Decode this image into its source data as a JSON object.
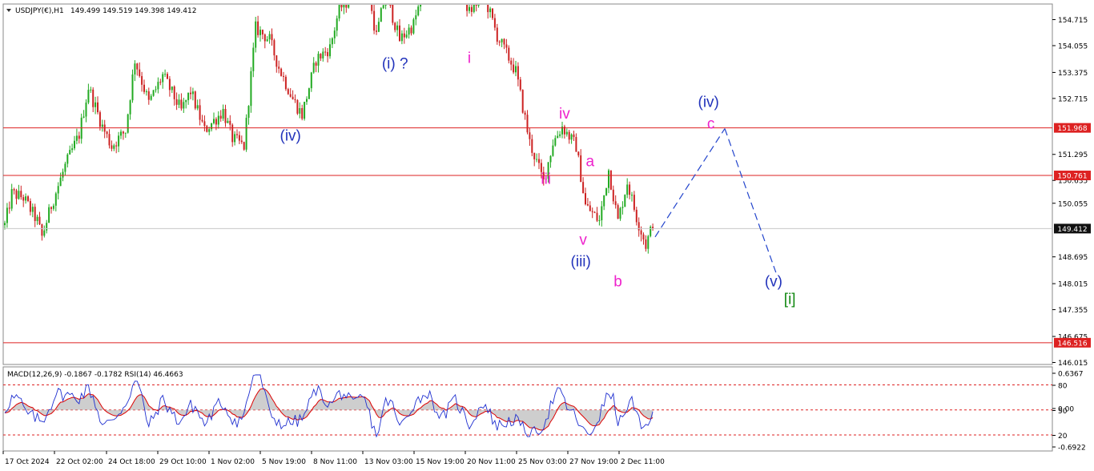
{
  "header": {
    "symbol": "USDJPY(€),H1",
    "ohlc": "149.499 149.519 149.398 149.412",
    "dropdown_icon": "triangle-down-icon"
  },
  "indicator_header": "MACD(12,26,9) -0.1867 -0.1782  RSI(14) 46.4663",
  "colors": {
    "bull": "#22aa22",
    "bear": "#cc2222",
    "hline": "#dd2222",
    "wave_blue": "#2233bb",
    "wave_magenta": "#ee22cc",
    "wave_green": "#118811",
    "projection": "#2244cc",
    "rsi": "#1f2fd0",
    "signal": "#dd0000",
    "hist": "#bdbdbd"
  },
  "chart_data": {
    "type": "candlestick",
    "symbol": "USDJPY",
    "timeframe": "H1",
    "ylim": [
      146.015,
      155.3
    ],
    "y_ticks": [
      "154.715",
      "154.055",
      "153.375",
      "152.715",
      "151.295",
      "150.635",
      "150.055",
      "148.695",
      "148.015",
      "147.355",
      "146.675",
      "146.015"
    ],
    "x_ticks": [
      "17 Oct 2024",
      "22 Oct 02:00",
      "24 Oct 18:00",
      "29 Oct 10:00",
      "1 Nov 02:00",
      "5 Nov 19:00",
      "8 Nov 11:00",
      "13 Nov 03:00",
      "15 Nov 19:00",
      "20 Nov 11:00",
      "25 Nov 03:00",
      "27 Nov 19:00",
      "2 Dec 11:00"
    ],
    "path_anchors": [
      [
        0,
        149.5
      ],
      [
        3,
        150.3
      ],
      [
        8,
        150.2
      ],
      [
        14,
        149.6
      ],
      [
        16,
        149.2
      ],
      [
        20,
        150.0
      ],
      [
        26,
        151.0
      ],
      [
        32,
        151.8
      ],
      [
        36,
        153.0
      ],
      [
        42,
        152.0
      ],
      [
        46,
        151.5
      ],
      [
        52,
        151.9
      ],
      [
        56,
        153.7
      ],
      [
        62,
        152.6
      ],
      [
        68,
        153.3
      ],
      [
        76,
        152.4
      ],
      [
        80,
        152.9
      ],
      [
        86,
        151.9
      ],
      [
        94,
        152.4
      ],
      [
        98,
        151.7
      ],
      [
        103,
        151.5
      ],
      [
        108,
        154.5
      ],
      [
        114,
        154.2
      ],
      [
        118,
        153.5
      ],
      [
        124,
        152.7
      ],
      [
        128,
        152.3
      ],
      [
        134,
        153.7
      ],
      [
        140,
        154.0
      ],
      [
        144,
        155.0
      ],
      [
        150,
        155.3
      ],
      [
        154,
        156.1
      ],
      [
        160,
        154.3
      ],
      [
        164,
        155.4
      ],
      [
        170,
        154.2
      ],
      [
        176,
        154.6
      ],
      [
        182,
        155.8
      ],
      [
        188,
        155.2
      ],
      [
        194,
        155.9
      ],
      [
        200,
        154.9
      ],
      [
        206,
        155.4
      ],
      [
        212,
        154.3
      ],
      [
        220,
        153.4
      ],
      [
        226,
        151.6
      ],
      [
        232,
        150.6
      ],
      [
        236,
        151.6
      ],
      [
        240,
        152.0
      ],
      [
        246,
        151.5
      ],
      [
        250,
        150.0
      ],
      [
        256,
        149.6
      ],
      [
        260,
        150.9
      ],
      [
        264,
        149.6
      ],
      [
        268,
        150.6
      ],
      [
        272,
        149.7
      ],
      [
        276,
        149.0
      ],
      [
        279,
        149.5
      ]
    ],
    "horizontal_lines": [
      {
        "price": 151.968,
        "label": "151.968"
      },
      {
        "price": 150.761,
        "label": "150.761"
      },
      {
        "price": 146.516,
        "label": "146.516"
      }
    ],
    "current_price": {
      "price": 149.412,
      "label": "149.412"
    },
    "projection_path": [
      {
        "bar": 280,
        "price": 149.2
      },
      {
        "bar": 310,
        "price": 151.95
      },
      {
        "bar": 332,
        "price": 148.3
      }
    ],
    "wave_labels": [
      {
        "text": "(iv)",
        "bar": 123,
        "price": 151.65,
        "color": "blue"
      },
      {
        "text": "(i) ?",
        "bar": 168,
        "price": 153.48,
        "color": "blue"
      },
      {
        "text": "i",
        "bar": 200,
        "price": 153.62,
        "color": "magenta"
      },
      {
        "text": "iv",
        "bar": 241,
        "price": 152.2,
        "color": "magenta"
      },
      {
        "text": "iii",
        "bar": 233,
        "price": 150.55,
        "color": "magenta"
      },
      {
        "text": "a",
        "bar": 252,
        "price": 151.0,
        "color": "magenta"
      },
      {
        "text": "v",
        "bar": 249,
        "price": 149.0,
        "color": "magenta"
      },
      {
        "text": "(iii)",
        "bar": 248,
        "price": 148.45,
        "color": "blue"
      },
      {
        "text": "b",
        "bar": 264,
        "price": 147.95,
        "color": "magenta"
      },
      {
        "text": "(iv)",
        "bar": 303,
        "price": 152.5,
        "color": "blue"
      },
      {
        "text": "c",
        "bar": 304,
        "price": 151.95,
        "color": "magenta"
      },
      {
        "text": "(v)",
        "bar": 331,
        "price": 147.95,
        "color": "blue"
      },
      {
        "text": "[i]",
        "bar": 338,
        "price": 147.5,
        "color": "green"
      }
    ],
    "indicator": {
      "name": "MACD(12,26,9) / RSI(14)",
      "macd_main": -0.1867,
      "macd_signal": -0.1782,
      "rsi": 46.4663,
      "y_ticks": [
        "0.6367",
        "80",
        "0.00",
        "50",
        "20",
        "-0.6922"
      ],
      "levels": [
        80,
        50,
        20
      ]
    }
  }
}
